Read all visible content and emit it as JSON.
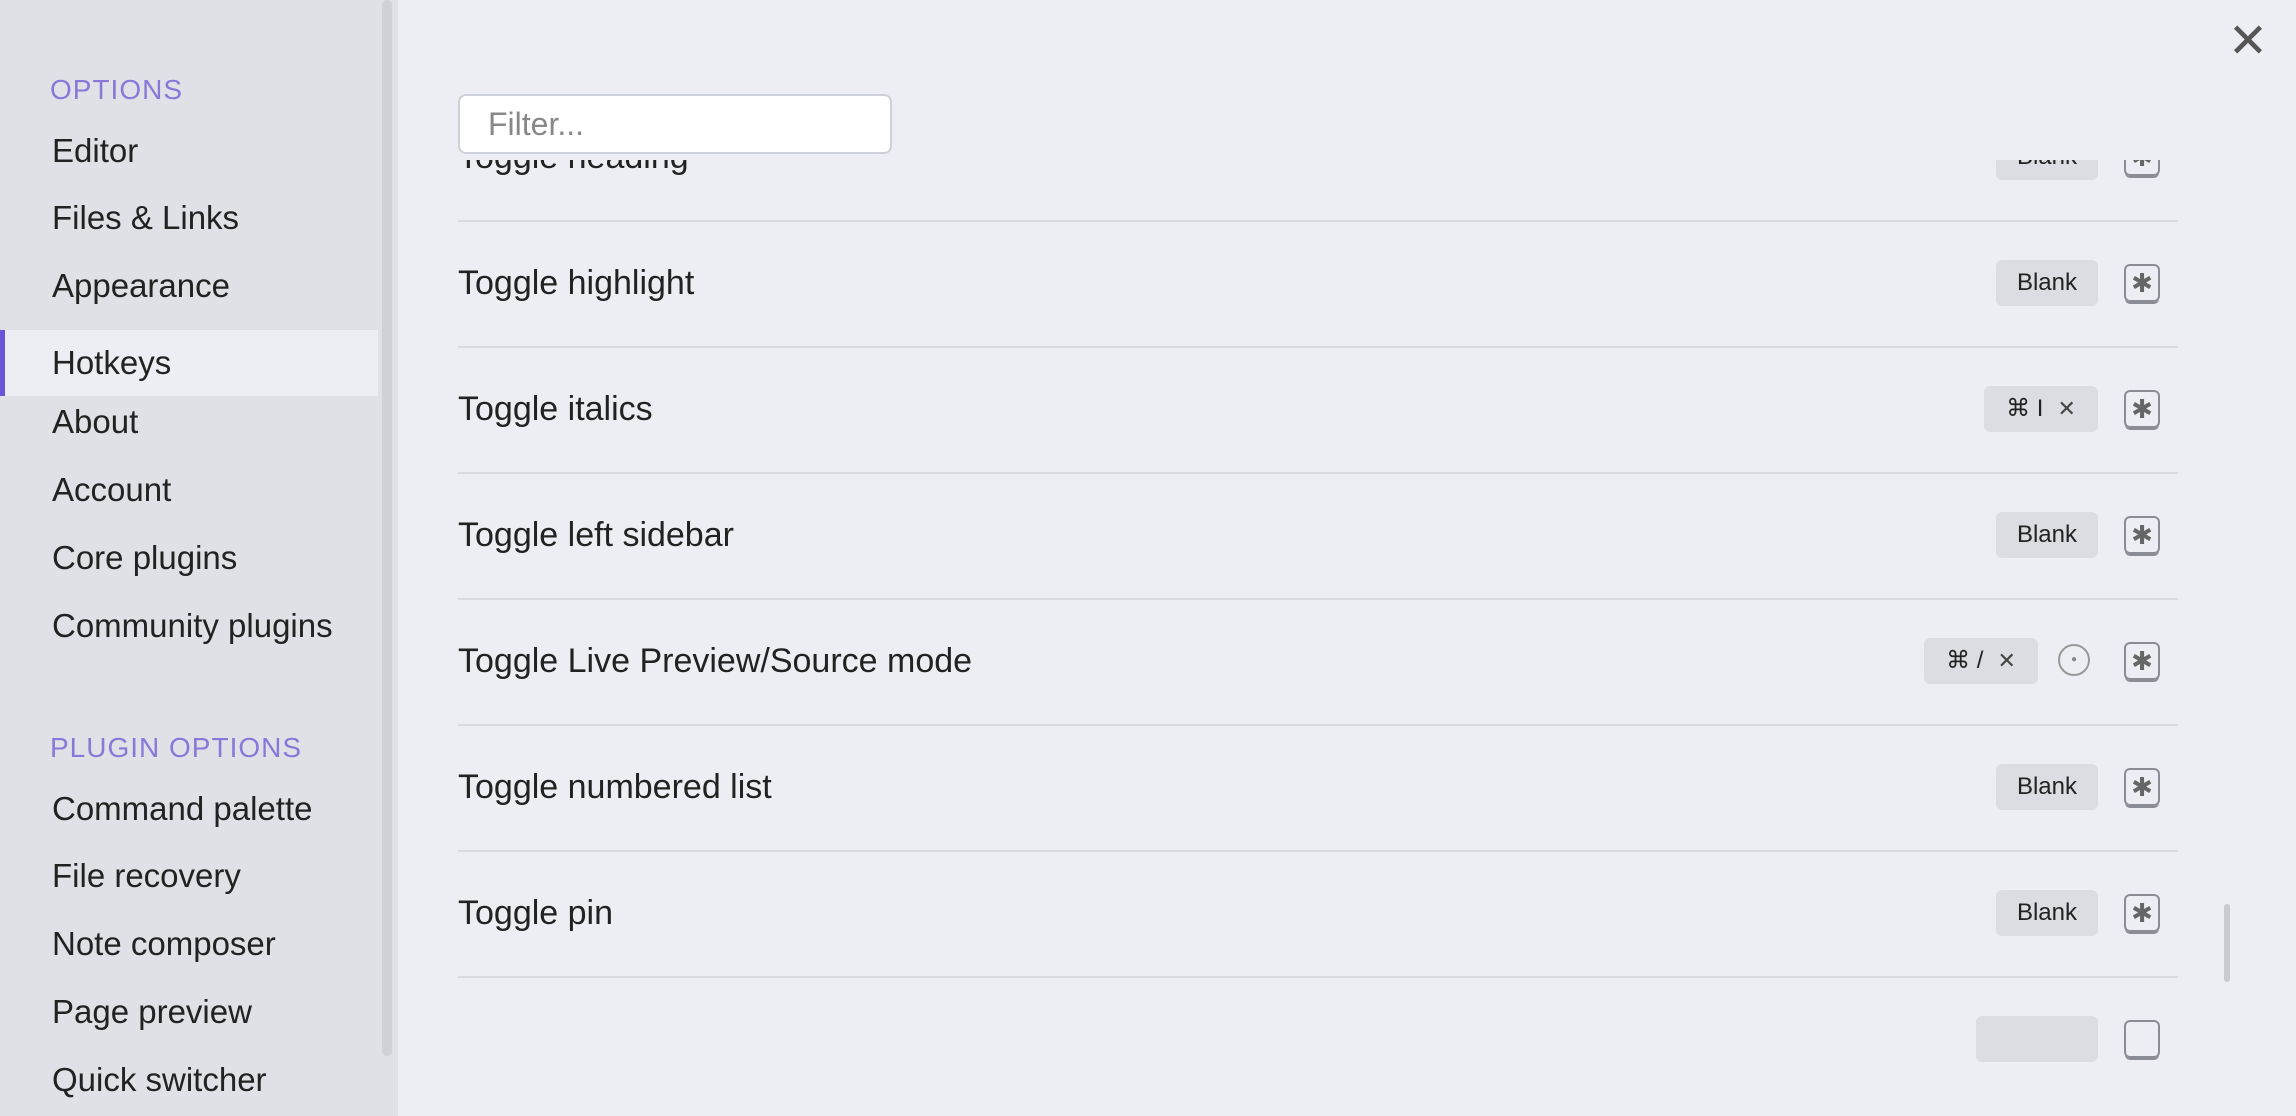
{
  "sidebar": {
    "options_header": "OPTIONS",
    "options": [
      "Editor",
      "Files & Links",
      "Appearance",
      "Hotkeys",
      "About",
      "Account",
      "Core plugins",
      "Community plugins"
    ],
    "plugin_header": "PLUGIN OPTIONS",
    "plugins": [
      "Command palette",
      "File recovery",
      "Note composer",
      "Page preview",
      "Quick switcher"
    ],
    "active": "Hotkeys"
  },
  "filter": {
    "placeholder": "Filter..."
  },
  "close_glyph": "✕",
  "hotkeys": [
    {
      "label": "Toggle heading",
      "hotkey": "Blank"
    },
    {
      "label": "Toggle highlight",
      "hotkey": "Blank"
    },
    {
      "label": "Toggle italics",
      "hotkey": "⌘ I"
    },
    {
      "label": "Toggle left sidebar",
      "hotkey": "Blank"
    },
    {
      "label": "Toggle Live Preview/Source mode",
      "hotkey": "⌘ /"
    },
    {
      "label": "Toggle numbered list",
      "hotkey": "Blank"
    },
    {
      "label": "Toggle pin",
      "hotkey": "Blank"
    }
  ]
}
